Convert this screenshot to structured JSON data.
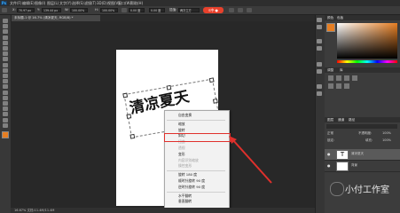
{
  "app": {
    "logo": "Ps",
    "menu_items": [
      "文件(F)",
      "编辑(E)",
      "图像(I)",
      "图层(L)",
      "文字(Y)",
      "选择(S)",
      "滤镜(T)",
      "3D(D)",
      "视图(V)",
      "窗口(W)",
      "帮助(H)"
    ],
    "badge": "S中·●"
  },
  "options": {
    "x_label": "X:",
    "x_value": "70.97 px",
    "y_label": "Y:",
    "y_value": "139.44 px",
    "w_label": "W:",
    "w_value": "100.00%",
    "h_label": "H:",
    "h_value": "100.00%",
    "angle_value": "0.00 度",
    "h_skew": "0.00 度",
    "interp_label": "插值:",
    "interp_value": "两次立方"
  },
  "document": {
    "tab_title": "未标题-1 @ 16.7% (清凉夏天, RGB/8) *",
    "canvas_text": "清凉夏天",
    "status": "16.67%   文档:11.4M/11.4M"
  },
  "context_menu": {
    "items": [
      {
        "label": "自由变换",
        "disabled": false
      },
      {
        "label": "缩放",
        "disabled": false
      },
      {
        "label": "旋转",
        "disabled": false
      },
      {
        "label": "斜切",
        "disabled": false
      },
      {
        "label": "扭曲",
        "disabled": true
      },
      {
        "label": "透视",
        "disabled": true
      },
      {
        "label": "变形",
        "disabled": false
      },
      {
        "label": "内容识别缩放",
        "disabled": true
      },
      {
        "label": "操控变形",
        "disabled": true
      },
      {
        "label": "旋转 180 度",
        "disabled": false
      },
      {
        "label": "顺时针旋转 90 度",
        "disabled": false
      },
      {
        "label": "逆时针旋转 90 度",
        "disabled": false
      },
      {
        "label": "水平翻转",
        "disabled": false
      },
      {
        "label": "垂直翻转",
        "disabled": false
      }
    ],
    "highlighted": "斜切",
    "highlight_color": "#e0302c"
  },
  "right_panel": {
    "tabs": [
      "颜色",
      "色板"
    ],
    "adjust_tab": "调整",
    "libraries_tab": "库",
    "layers_tabs": [
      "图层",
      "通道",
      "路径"
    ],
    "blend_mode": "正常",
    "opacity_label": "不透明度:",
    "opacity_value": "100%",
    "lock_label": "锁定:",
    "fill_label": "填充:",
    "fill_value": "100%",
    "layers": [
      {
        "name": "清凉夏天",
        "type": "text"
      },
      {
        "name": "背景",
        "type": "image"
      }
    ]
  },
  "watermark": {
    "text": "小付工作室"
  },
  "colors": {
    "accent": "#31a8ff",
    "annotation_red": "#e0302c",
    "badge_red": "#e8412c"
  },
  "icons": [
    "move-icon",
    "marquee-icon",
    "lasso-icon",
    "quick-select-icon",
    "crop-icon",
    "eyedropper-icon",
    "healing-icon",
    "brush-icon",
    "stamp-icon",
    "history-brush-icon",
    "eraser-icon",
    "gradient-icon",
    "blur-icon",
    "dodge-icon",
    "pen-icon",
    "type-icon",
    "path-select-icon",
    "shape-icon",
    "hand-icon",
    "zoom-icon"
  ]
}
